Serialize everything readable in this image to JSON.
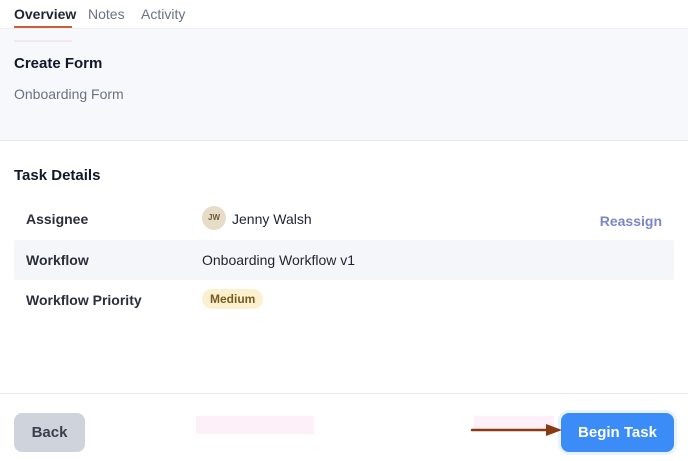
{
  "tabs": [
    {
      "label": "Overview",
      "active": true
    },
    {
      "label": "Notes",
      "active": false
    },
    {
      "label": "Activity",
      "active": false
    }
  ],
  "form": {
    "title": "Create Form",
    "name": "Onboarding Form"
  },
  "task_details": {
    "title": "Task Details",
    "assignee": {
      "label": "Assignee",
      "avatar_initials": "JW",
      "name": "Jenny Walsh",
      "action": "Reassign"
    },
    "workflow": {
      "label": "Workflow",
      "value": "Onboarding Workflow v1"
    },
    "priority": {
      "label": "Workflow Priority",
      "value": "Medium"
    }
  },
  "footer": {
    "back_label": "Back",
    "begin_label": "Begin Task"
  },
  "colors": {
    "accent": "#3b8cf7",
    "tab_underline": "#c9603a",
    "link": "#7b86c9",
    "priority_bg": "#fbf0d0",
    "arrow": "#8a3a12"
  }
}
